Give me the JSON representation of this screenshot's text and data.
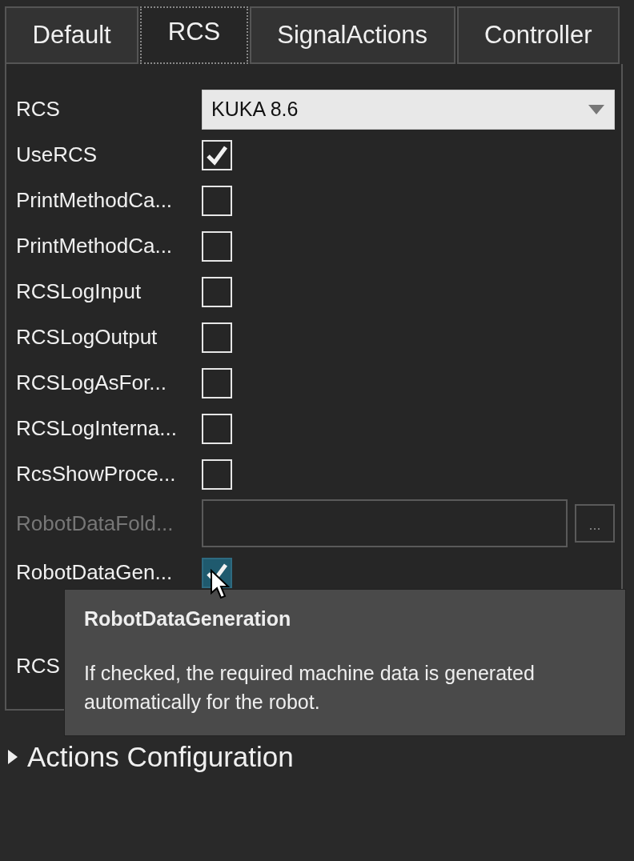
{
  "tabs": [
    {
      "label": "Default",
      "selected": false
    },
    {
      "label": "RCS",
      "selected": true
    },
    {
      "label": "SignalActions",
      "selected": false
    },
    {
      "label": "Controller",
      "selected": false
    }
  ],
  "rows": [
    {
      "kind": "dropdown",
      "label": "RCS",
      "value": "KUKA 8.6"
    },
    {
      "kind": "checkbox",
      "label": "UseRCS",
      "checked": true
    },
    {
      "kind": "checkbox",
      "label": "PrintMethodCa...",
      "checked": false
    },
    {
      "kind": "checkbox",
      "label": "PrintMethodCa...",
      "checked": false
    },
    {
      "kind": "checkbox",
      "label": "RCSLogInput",
      "checked": false
    },
    {
      "kind": "checkbox",
      "label": "RCSLogOutput",
      "checked": false
    },
    {
      "kind": "checkbox",
      "label": "RCSLogAsFor...",
      "checked": false
    },
    {
      "kind": "checkbox",
      "label": "RCSLogInterna...",
      "checked": false
    },
    {
      "kind": "checkbox",
      "label": "RcsShowProce...",
      "checked": false
    },
    {
      "kind": "folder",
      "label": "RobotDataFold...",
      "disabled": true,
      "button": "..."
    },
    {
      "kind": "checkbox",
      "label": "RobotDataGen...",
      "checked": true,
      "hovered": true
    },
    {
      "kind": "covered",
      "label": "RCS"
    }
  ],
  "section": {
    "label": "Actions Configuration",
    "expanded": false
  },
  "tooltip": {
    "title": "RobotDataGeneration",
    "text": "If checked, the required machine data is generated automatically for the robot."
  }
}
